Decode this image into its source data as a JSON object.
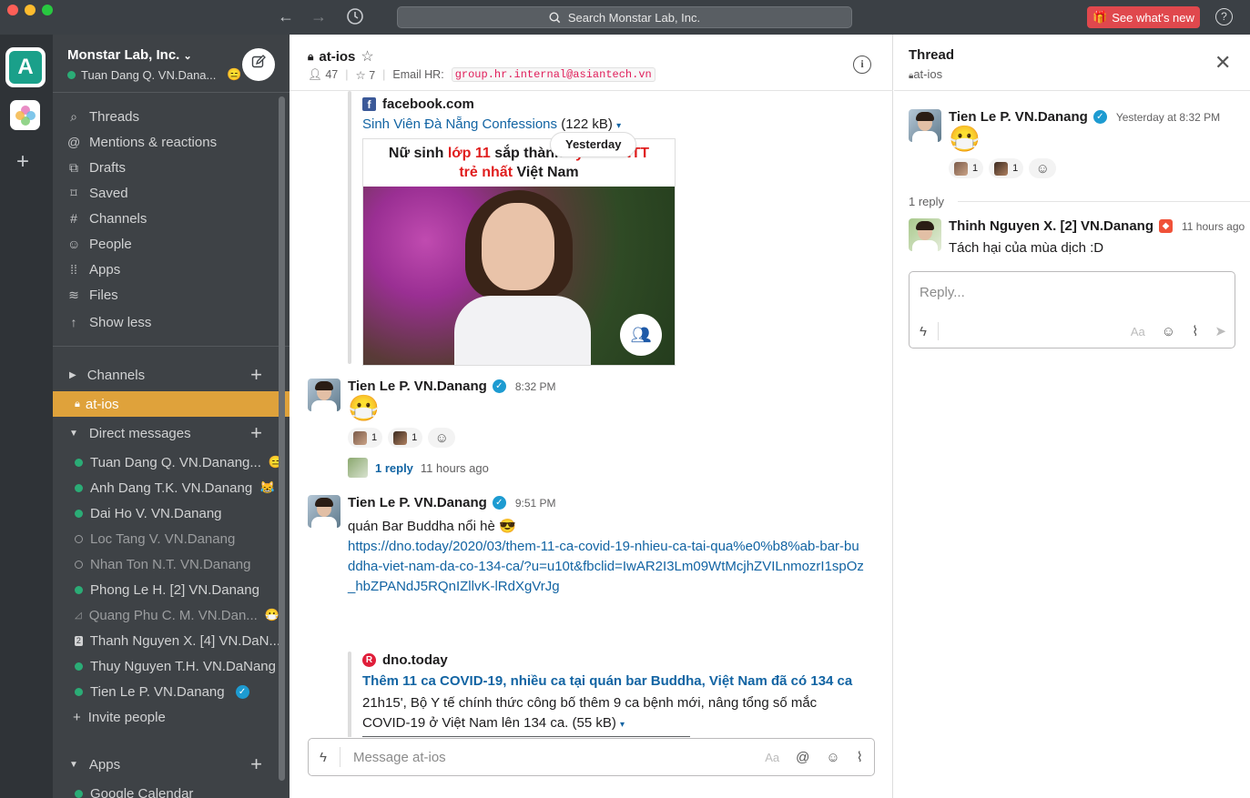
{
  "titlebar": {
    "search_placeholder": "Search Monstar Lab, Inc.",
    "whats_new": "See what's new",
    "help": "?"
  },
  "sidebar": {
    "team": "Monstar Lab, Inc.",
    "user": "Tuan Dang Q. VN.Dana...",
    "nav": [
      "Threads",
      "Mentions & reactions",
      "Drafts",
      "Saved",
      "Channels",
      "People",
      "Apps",
      "Files",
      "Show less"
    ],
    "channels_header": "Channels",
    "active_channel": "at-ios",
    "dm_header": "Direct messages",
    "dms": [
      {
        "name": "Tuan Dang Q. VN.Danang...",
        "status": "on",
        "badge": "😑"
      },
      {
        "name": "Anh Dang T.K. VN.Danang",
        "status": "on",
        "badge": "😹"
      },
      {
        "name": "Dai Ho V. VN.Danang",
        "status": "on",
        "badge": ""
      },
      {
        "name": "Loc Tang V. VN.Danang",
        "status": "off",
        "badge": ""
      },
      {
        "name": "Nhan Ton N.T. VN.Danang",
        "status": "off",
        "badge": ""
      },
      {
        "name": "Phong Le H. [2] VN.Danang",
        "status": "on",
        "badge": ""
      },
      {
        "name": "Quang Phu C. M. VN.Dan...",
        "status": "group",
        "badge": "😷"
      },
      {
        "name": "Thanh Nguyen X. [4] VN.DaN...",
        "status": "num",
        "badge": ""
      },
      {
        "name": "Thuy Nguyen T.H. VN.DaNang",
        "status": "on",
        "badge": ""
      },
      {
        "name": "Tien Le P. VN.Danang",
        "status": "on",
        "badge": "✓"
      }
    ],
    "invite": "Invite people",
    "apps_header": "Apps",
    "apps": [
      "Google Calendar"
    ]
  },
  "channel": {
    "name": "at-ios",
    "members": "47",
    "pins": "7",
    "email_label": "Email HR:",
    "email": "group.hr.internal@asiantech.vn",
    "date_divider": "Yesterday",
    "fb_attachment": {
      "source": "facebook.com",
      "title": "Sinh Viên Đà Nẵng Confessions",
      "size": "(122 kB)",
      "caption_1a": "Nữ sinh ",
      "caption_1b": "lớp 11",
      "caption_1c": " sắp thành ",
      "caption_1d": "kỹ sư CNTT",
      "caption_2a": "trẻ nhất",
      "caption_2b": " Việt Nam"
    },
    "msg1": {
      "author": "Tien Le P. VN.Danang",
      "time": "8:32 PM",
      "emoji": "😷",
      "reaction_counts": [
        "1",
        "1"
      ],
      "reply_count": "1 reply",
      "reply_ago": "11 hours ago"
    },
    "msg2": {
      "author": "Tien Le P. VN.Danang",
      "time": "9:51 PM",
      "text": "quán Bar Buddha nổi hè 😎",
      "url": "https://dno.today/2020/03/them-11-ca-covid-19-nhieu-ca-tai-qua%e0%b8%ab-bar-buddha-viet-nam-da-co-134-ca/?u=u10t&fbclid=IwAR2I3Lm09WtMcjhZVILnmozrI1spOz_hbZPANdJ5RQnIZllvK-lRdXgVrJg",
      "source": "dno.today",
      "link_title": "Thêm 11 ca COVID-19, nhiều ca tại quán bar Buddha, Việt Nam đã có 134 ca",
      "desc": "21h15', Bộ Y tế chính thức công bố thêm 9 ca bệnh mới, nâng tổng số mắc COVID-19 ở Việt Nam lên 134 ca. (55 kB)"
    },
    "composer_placeholder": "Message at-ios"
  },
  "thread": {
    "title": "Thread",
    "channel": "at-ios",
    "parent": {
      "author": "Tien Le P. VN.Danang",
      "time": "Yesterday at 8:32 PM",
      "emoji": "😷",
      "reaction_counts": [
        "1",
        "1"
      ]
    },
    "reply_count": "1 reply",
    "reply": {
      "author": "Thinh Nguyen X. [2] VN.Danang",
      "time": "11 hours ago",
      "text": "Tách hại của mùa dịch :D"
    },
    "reply_placeholder": "Reply..."
  }
}
